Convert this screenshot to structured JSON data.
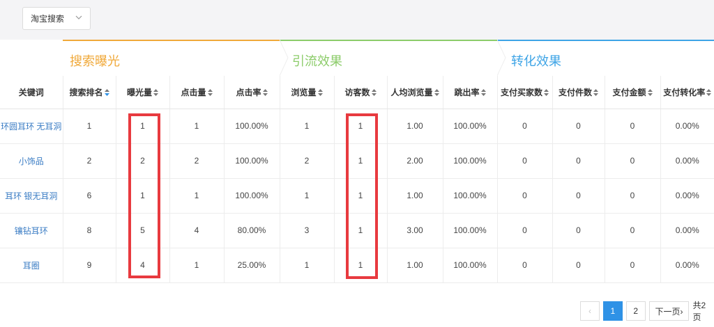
{
  "filter": {
    "selected": "淘宝搜索"
  },
  "groups": [
    {
      "label": "搜索曝光",
      "color": "#f0a93a"
    },
    {
      "label": "引流效果",
      "color": "#8ccc6a"
    },
    {
      "label": "转化效果",
      "color": "#3ea4e6"
    }
  ],
  "columns": [
    "关键词",
    "搜索排名",
    "曝光量",
    "点击量",
    "点击率",
    "浏览量",
    "访客数",
    "人均浏览量",
    "跳出率",
    "支付买家数",
    "支付件数",
    "支付金额",
    "支付转化率"
  ],
  "rows": [
    [
      "环圆耳环 无耳洞",
      "1",
      "1",
      "1",
      "100.00%",
      "1",
      "1",
      "1.00",
      "100.00%",
      "0",
      "0",
      "0",
      "0.00%"
    ],
    [
      "小饰品",
      "2",
      "2",
      "2",
      "100.00%",
      "2",
      "1",
      "2.00",
      "100.00%",
      "0",
      "0",
      "0",
      "0.00%"
    ],
    [
      "耳环 银无耳洞",
      "6",
      "1",
      "1",
      "100.00%",
      "1",
      "1",
      "1.00",
      "100.00%",
      "0",
      "0",
      "0",
      "0.00%"
    ],
    [
      "镶钻耳环",
      "8",
      "5",
      "4",
      "80.00%",
      "3",
      "1",
      "3.00",
      "100.00%",
      "0",
      "0",
      "0",
      "0.00%"
    ],
    [
      "耳圈",
      "9",
      "4",
      "1",
      "25.00%",
      "1",
      "1",
      "1.00",
      "100.00%",
      "0",
      "0",
      "0",
      "0.00%"
    ]
  ],
  "pagination": {
    "prev": "‹",
    "pages": [
      "1",
      "2"
    ],
    "current": "1",
    "next": "下一页›",
    "total": "共2页"
  },
  "colors": {
    "link": "#3a7cc4",
    "highlight": "#e83a3f",
    "page_active": "#2f92e6"
  }
}
